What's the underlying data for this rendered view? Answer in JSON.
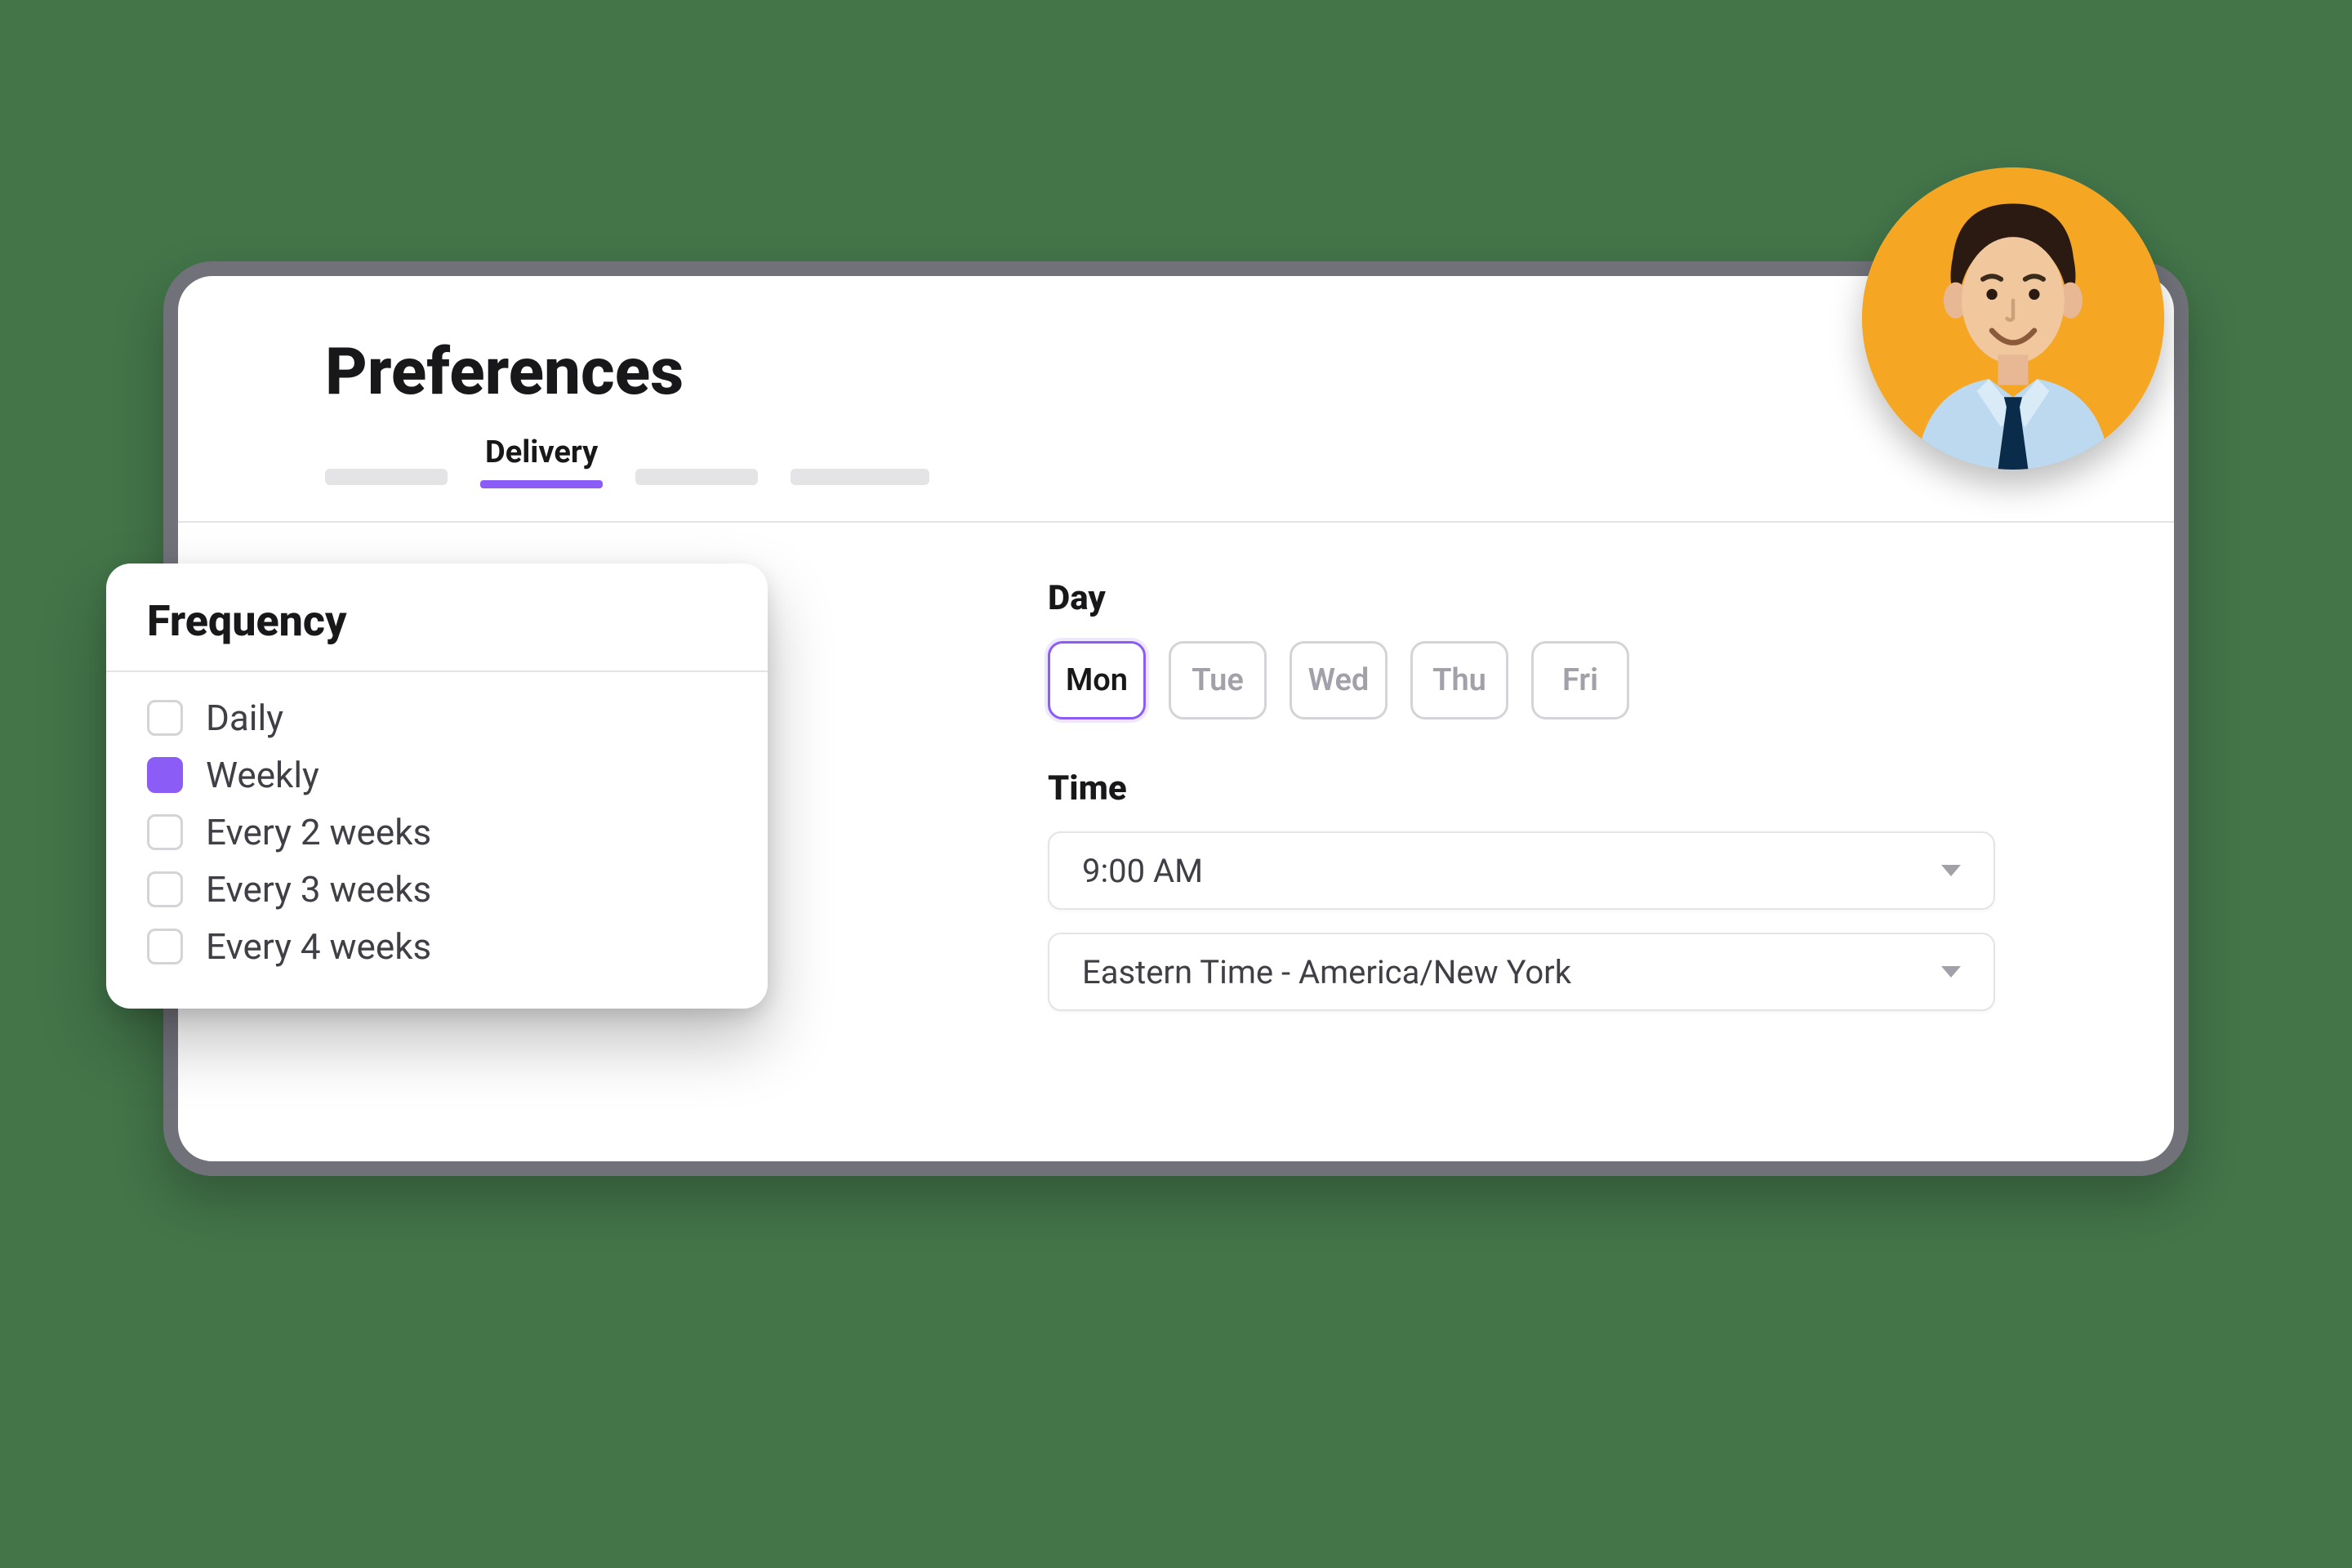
{
  "header": {
    "title": "Preferences",
    "active_tab_label": "Delivery"
  },
  "frequency": {
    "title": "Frequency",
    "options": [
      {
        "label": "Daily",
        "checked": false
      },
      {
        "label": "Weekly",
        "checked": true
      },
      {
        "label": "Every 2 weeks",
        "checked": false
      },
      {
        "label": "Every 3 weeks",
        "checked": false
      },
      {
        "label": "Every 4 weeks",
        "checked": false
      }
    ]
  },
  "day": {
    "label": "Day",
    "options": [
      {
        "label": "Mon",
        "selected": true
      },
      {
        "label": "Tue",
        "selected": false
      },
      {
        "label": "Wed",
        "selected": false
      },
      {
        "label": "Thu",
        "selected": false
      },
      {
        "label": "Fri",
        "selected": false
      }
    ]
  },
  "time": {
    "label": "Time",
    "value": "9:00 AM",
    "timezone": "Eastern Time - America/New York"
  },
  "colors": {
    "accent": "#8b5cf6",
    "avatar_bg": "#f5a623",
    "card_border": "#71717a",
    "page_bg": "#437549"
  }
}
